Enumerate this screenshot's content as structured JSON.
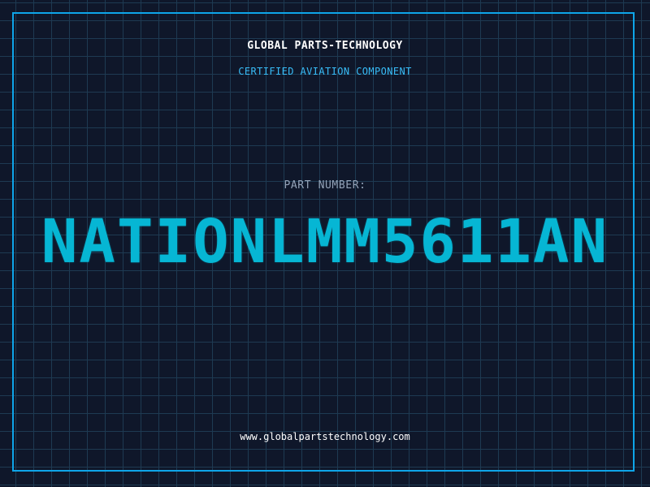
{
  "header": {
    "company": "GLOBAL PARTS-TECHNOLOGY",
    "tagline": "CERTIFIED AVIATION COMPONENT"
  },
  "part": {
    "label": "PART NUMBER:",
    "number": "NATIONLMM5611AN"
  },
  "footer": {
    "website": "www.globalpartstechnology.com"
  },
  "colors": {
    "background": "#0f172a",
    "grid": "#1e3a52",
    "accent": "#0ea5e9",
    "part_number": "#06b6d4"
  }
}
